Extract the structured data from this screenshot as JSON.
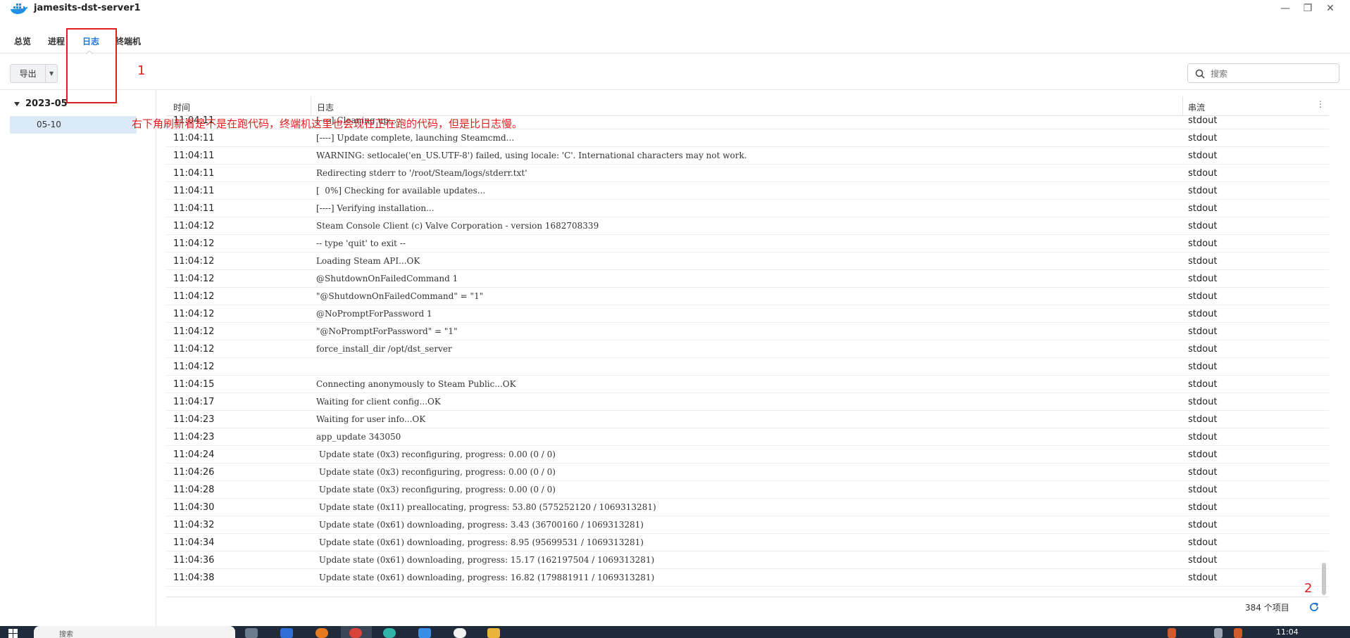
{
  "window": {
    "title": "jamesits-dst-server1",
    "controls": {
      "minimize": "—",
      "restore": "❐",
      "close": "✕"
    }
  },
  "tabs": [
    {
      "label": "总览",
      "active": false
    },
    {
      "label": "进程",
      "active": false
    },
    {
      "label": "日志",
      "active": true
    },
    {
      "label": "终端机",
      "active": false
    }
  ],
  "toolbar": {
    "export_label": "导出",
    "search_placeholder": "搜索"
  },
  "sidebar": {
    "year": "2023-05",
    "day": "05-10"
  },
  "table": {
    "columns": {
      "time": "时间",
      "log": "日志",
      "stream": "串流"
    },
    "partial_row": {
      "time": "11:04:11",
      "log": "[----] Cleaning up...",
      "stream": "stdout"
    },
    "rows": [
      {
        "time": "11:04:11",
        "log": "[----] Update complete, launching Steamcmd...",
        "stream": "stdout"
      },
      {
        "time": "11:04:11",
        "log": "WARNING: setlocale('en_US.UTF-8') failed, using locale: 'C'. International characters may not work.",
        "stream": "stdout"
      },
      {
        "time": "11:04:11",
        "log": "Redirecting stderr to '/root/Steam/logs/stderr.txt'",
        "stream": "stdout"
      },
      {
        "time": "11:04:11",
        "log": "[  0%] Checking for available updates...",
        "stream": "stdout"
      },
      {
        "time": "11:04:11",
        "log": "[----] Verifying installation...",
        "stream": "stdout"
      },
      {
        "time": "11:04:12",
        "log": "Steam Console Client (c) Valve Corporation - version 1682708339",
        "stream": "stdout"
      },
      {
        "time": "11:04:12",
        "log": "-- type 'quit' to exit --",
        "stream": "stdout"
      },
      {
        "time": "11:04:12",
        "log": "Loading Steam API...OK",
        "stream": "stdout"
      },
      {
        "time": "11:04:12",
        "log": "@ShutdownOnFailedCommand 1",
        "stream": "stdout"
      },
      {
        "time": "11:04:12",
        "log": "\"@ShutdownOnFailedCommand\" = \"1\"",
        "stream": "stdout"
      },
      {
        "time": "11:04:12",
        "log": "@NoPromptForPassword 1",
        "stream": "stdout"
      },
      {
        "time": "11:04:12",
        "log": "\"@NoPromptForPassword\" = \"1\"",
        "stream": "stdout"
      },
      {
        "time": "11:04:12",
        "log": "force_install_dir /opt/dst_server",
        "stream": "stdout"
      },
      {
        "time": "11:04:12",
        "log": "",
        "stream": "stdout"
      },
      {
        "time": "11:04:15",
        "log": "Connecting anonymously to Steam Public...OK",
        "stream": "stdout"
      },
      {
        "time": "11:04:17",
        "log": "Waiting for client config...OK",
        "stream": "stdout"
      },
      {
        "time": "11:04:23",
        "log": "Waiting for user info...OK",
        "stream": "stdout"
      },
      {
        "time": "11:04:23",
        "log": "app_update 343050",
        "stream": "stdout"
      },
      {
        "time": "11:04:24",
        "log": " Update state (0x3) reconfiguring, progress: 0.00 (0 / 0)",
        "stream": "stdout"
      },
      {
        "time": "11:04:26",
        "log": " Update state (0x3) reconfiguring, progress: 0.00 (0 / 0)",
        "stream": "stdout"
      },
      {
        "time": "11:04:28",
        "log": " Update state (0x3) reconfiguring, progress: 0.00 (0 / 0)",
        "stream": "stdout"
      },
      {
        "time": "11:04:30",
        "log": " Update state (0x11) preallocating, progress: 53.80 (575252120 / 1069313281)",
        "stream": "stdout"
      },
      {
        "time": "11:04:32",
        "log": " Update state (0x61) downloading, progress: 3.43 (36700160 / 1069313281)",
        "stream": "stdout"
      },
      {
        "time": "11:04:34",
        "log": " Update state (0x61) downloading, progress: 8.95 (95699531 / 1069313281)",
        "stream": "stdout"
      },
      {
        "time": "11:04:36",
        "log": " Update state (0x61) downloading, progress: 15.17 (162197504 / 1069313281)",
        "stream": "stdout"
      },
      {
        "time": "11:04:38",
        "log": " Update state (0x61) downloading, progress: 16.82 (179881911 / 1069313281)",
        "stream": "stdout"
      }
    ]
  },
  "footer": {
    "count": "384 个项目"
  },
  "annotations": {
    "label_1": "1",
    "label_2": "2",
    "note": "右下角刷新看是不是在跑代码，终端机这里也会现在正在跑的代码，但是比日志慢。"
  },
  "taskbar": {
    "search_placeholder": "搜索",
    "clock": "11:04"
  },
  "colors": {
    "accent": "#1b74d0",
    "annotation": "#e02020",
    "selected_bg": "#dce9f7",
    "taskbar_bg": "#1f2b3a"
  }
}
